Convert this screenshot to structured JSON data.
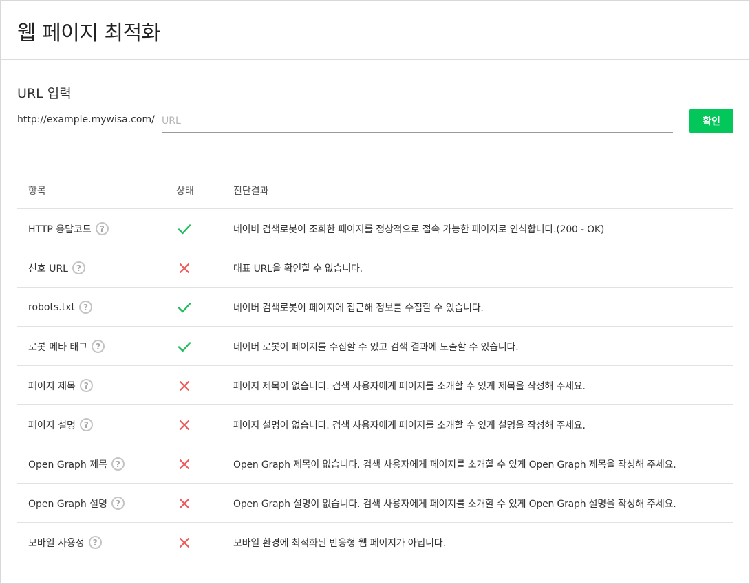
{
  "header": {
    "title": "웹 페이지 최적화"
  },
  "url_section": {
    "title": "URL 입력",
    "prefix": "http://example.mywisa.com/",
    "input_placeholder": "URL",
    "input_value": "",
    "confirm_label": "확인"
  },
  "table": {
    "columns": [
      "항목",
      "상태",
      "진단결과"
    ],
    "rows": [
      {
        "item": "HTTP 응답코드",
        "status": "pass",
        "result": "네이버 검색로봇이 조회한 페이지를 정상적으로 접속 가능한 페이지로 인식합니다.(200 - OK)"
      },
      {
        "item": "선호 URL",
        "status": "fail",
        "result": "대표 URL을 확인할 수 없습니다."
      },
      {
        "item": "robots.txt",
        "status": "pass",
        "result": "네이버 검색로봇이 페이지에 접근해 정보를 수집할 수 있습니다."
      },
      {
        "item": "로봇 메타 태그",
        "status": "pass",
        "result": "네이버 로봇이 페이지를 수집할 수 있고 검색 결과에 노출할 수 있습니다."
      },
      {
        "item": "페이지 제목",
        "status": "fail",
        "result": "페이지 제목이 없습니다. 검색 사용자에게 페이지를 소개할 수 있게 제목을 작성해 주세요."
      },
      {
        "item": "페이지 설명",
        "status": "fail",
        "result": "페이지 설명이 없습니다. 검색 사용자에게 페이지를 소개할 수 있게 설명을 작성해 주세요."
      },
      {
        "item": "Open Graph 제목",
        "status": "fail",
        "result": "Open Graph 제목이 없습니다. 검색 사용자에게 페이지를 소개할 수 있게 Open Graph 제목을 작성해 주세요."
      },
      {
        "item": "Open Graph 설명",
        "status": "fail",
        "result": "Open Graph 설명이 없습니다. 검색 사용자에게 페이지를 소개할 수 있게 Open Graph 설명을 작성해 주세요."
      },
      {
        "item": "모바일 사용성",
        "status": "fail",
        "result": "모바일 환경에 최적화된 반응형 웹 페이지가 아닙니다."
      }
    ]
  },
  "help_glyph": "?",
  "icons": {
    "pass": "check-icon",
    "fail": "cross-icon",
    "help": "question-circle-icon"
  },
  "colors": {
    "accent": "#03c75a",
    "pass": "#1fbd5c",
    "fail": "#ee5a5a",
    "border": "#e2e2e2"
  }
}
